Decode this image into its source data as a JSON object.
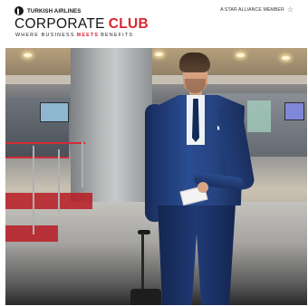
{
  "header": {
    "airline_name": "TURKISH AIRLINES",
    "alliance_text": "A STAR ALLIANCE MEMBER",
    "title_word1": "CORPORATE",
    "title_word2": "CLUB",
    "tagline": {
      "part1": "WHERE BUSINESS",
      "part2": "MEETS",
      "part3": "BENEFITS"
    }
  },
  "icons": {
    "airline_logo": "turkish-airlines-logo-icon",
    "alliance_logo": "star-alliance-icon"
  },
  "colors": {
    "brand_red": "#d8262f",
    "text_dark": "#151515"
  }
}
